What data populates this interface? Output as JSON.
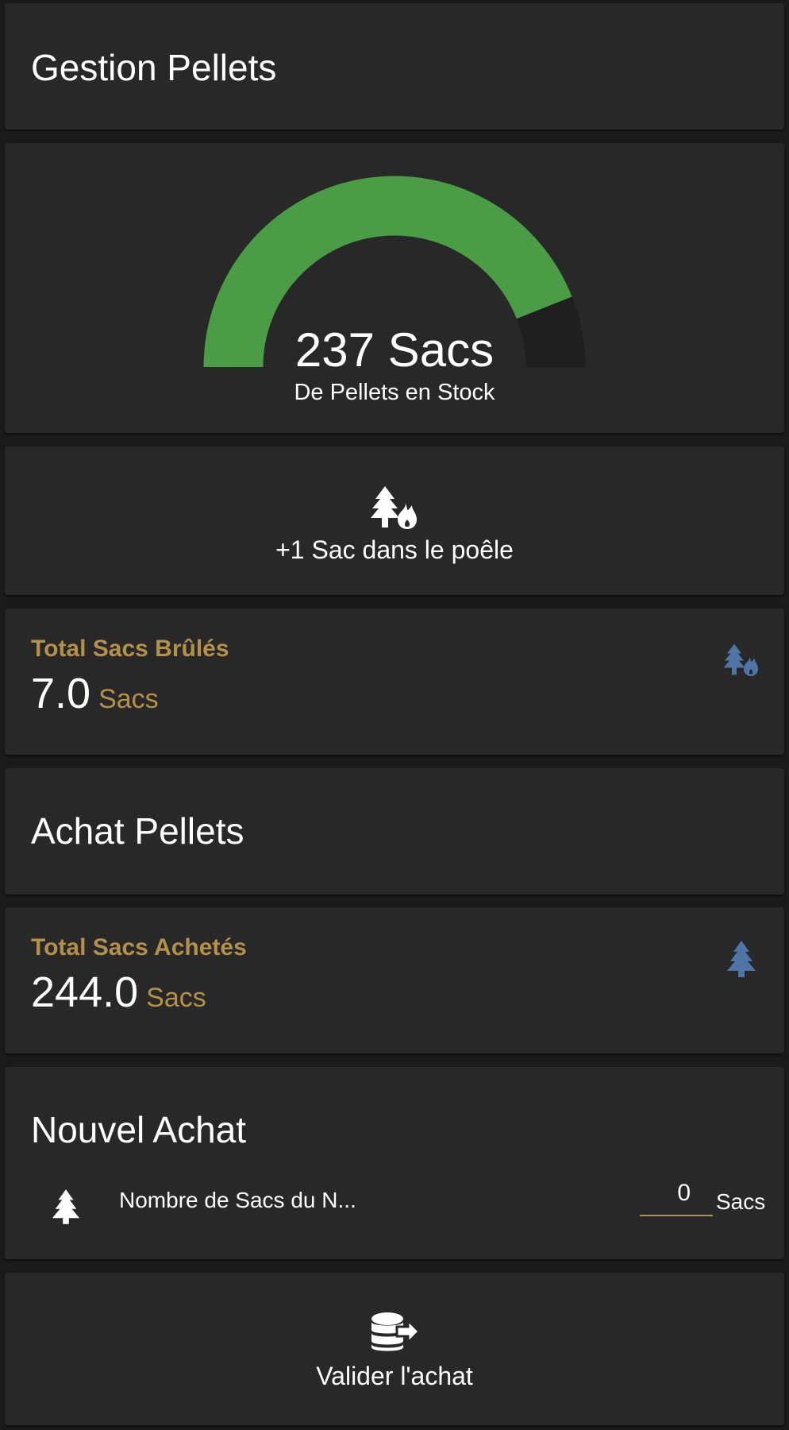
{
  "section1": {
    "title": "Gestion Pellets"
  },
  "gauge": {
    "value": 237,
    "value_text": "237 Sacs",
    "label": "De Pellets en Stock",
    "fill_fraction": 0.88,
    "fill_color": "#4a9c45",
    "track_color": "#1f1f1f"
  },
  "burn_button": {
    "label": "+1 Sac dans le poêle",
    "icon": "tree-fire-icon"
  },
  "burned": {
    "name": "Total Sacs Brûlés",
    "value": "7.0",
    "unit": "Sacs",
    "icon": "tree-fire-icon",
    "icon_color": "#4f74a6"
  },
  "section2": {
    "title": "Achat Pellets"
  },
  "bought": {
    "name": "Total Sacs Achetés",
    "value": "244.0",
    "unit": "Sacs",
    "icon": "pine-tree-icon",
    "icon_color": "#4f74a6"
  },
  "new_purchase": {
    "title": "Nouvel Achat",
    "row_label": "Nombre de Sacs du N...",
    "input_value": "0",
    "unit": "Sacs",
    "icon": "pine-tree-icon"
  },
  "validate_button": {
    "label": "Valider l'achat",
    "icon": "database-export-icon"
  },
  "colors": {
    "card": "#282828",
    "accent": "#b49149",
    "icon_blue": "#4f74a6",
    "gauge_green": "#4a9c45"
  }
}
